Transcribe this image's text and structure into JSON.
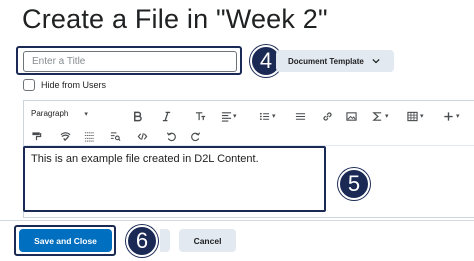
{
  "page": {
    "title": "Create a File in \"Week 2\""
  },
  "title_field": {
    "placeholder": "Enter a Title",
    "value": ""
  },
  "document_template": {
    "label": "Document Template",
    "icon": "chevron-down-icon"
  },
  "hide_from_users": {
    "label": "Hide from Users",
    "checked": false
  },
  "toolbar": {
    "paragraph_label": "Paragraph",
    "row1_icons": [
      "bold-icon",
      "italic-icon",
      "align-icon",
      "list-icon",
      "link-icon",
      "image-icon",
      "equation-icon",
      "table-icon",
      "insert-icon"
    ],
    "row2_icons": [
      "format-painter-icon",
      "accessibility-checker-icon",
      "line-spacing-icon",
      "find-replace-icon",
      "source-code-icon",
      "undo-icon",
      "redo-icon"
    ]
  },
  "editor": {
    "content": "This is an example file created in D2L Content."
  },
  "badges": {
    "step4": "4",
    "step5": "5",
    "step6": "6"
  },
  "footer": {
    "save_label": "Save and Close",
    "cancel_label": "Cancel"
  },
  "colors": {
    "primary": "#006fbf",
    "annotation": "#1b2a55",
    "secondary_button": "#e3e9f1"
  }
}
